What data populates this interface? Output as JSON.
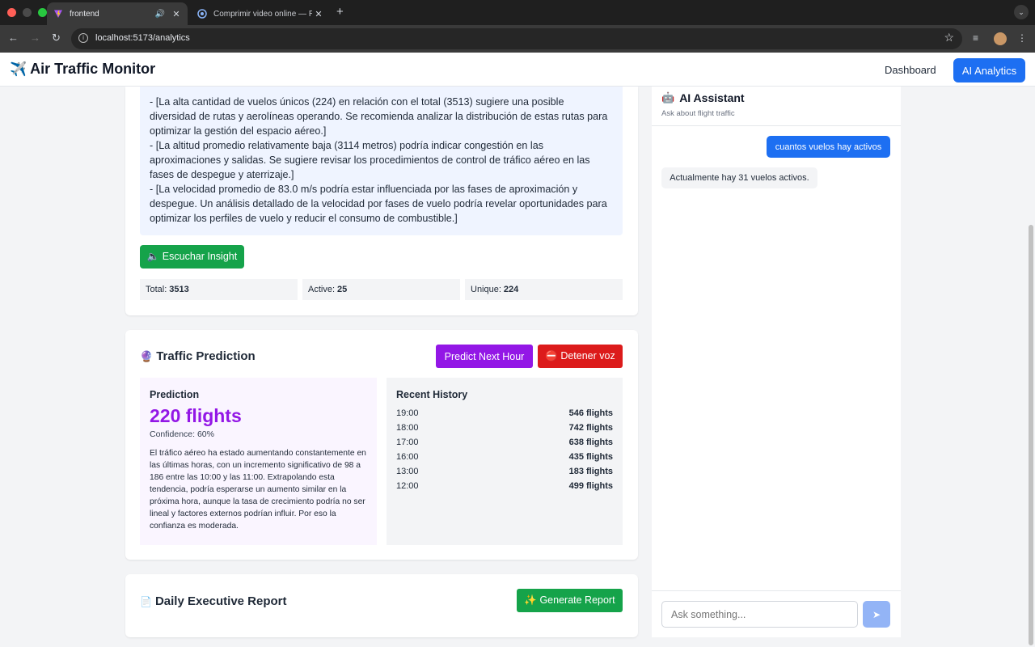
{
  "browser": {
    "tabs": [
      {
        "title": "frontend",
        "favicon": "vite-icon",
        "active": true
      },
      {
        "title": "Comprimir video online — Re",
        "favicon": "compress-icon",
        "active": false
      }
    ],
    "new_tab_symbol": "+",
    "url": "localhost:5173/analytics",
    "close_symbol": "✕",
    "audio_symbol": "🔊",
    "star_symbol": "☆"
  },
  "header": {
    "brand_icon": "✈️",
    "brand": "Air Traffic Monitor",
    "nav": {
      "dashboard": "Dashboard",
      "ai_analytics": "AI Analytics"
    }
  },
  "insight": {
    "paragraphs": [
      "- [La alta cantidad de vuelos únicos (224) en relación con el total (3513) sugiere una posible diversidad de rutas y aerolíneas operando. Se recomienda analizar la distribución de estas rutas para optimizar la gestión del espacio aéreo.]",
      "- [La altitud promedio relativamente baja (3114 metros) podría indicar congestión en las aproximaciones y salidas. Se sugiere revisar los procedimientos de control de tráfico aéreo en las fases de despegue y aterrizaje.]",
      "- [La velocidad promedio de 83.0 m/s podría estar influenciada por las fases de aproximación y despegue. Un análisis detallado de la velocidad por fases de vuelo podría revelar oportunidades para optimizar los perfiles de vuelo y reducir el consumo de combustible.]"
    ],
    "listen_button": "🔈 Escuchar Insight",
    "stats": {
      "total_label": "Total:",
      "total": "3513",
      "active_label": "Active:",
      "active": "25",
      "unique_label": "Unique:",
      "unique": "224"
    }
  },
  "prediction": {
    "icon": "🔮",
    "title": "Traffic Prediction",
    "predict_button": "Predict Next Hour",
    "stop_button": "⛔ Detener voz",
    "box_title": "Prediction",
    "value": "220 flights",
    "confidence": "Confidence: 60%",
    "description": "El tráfico aéreo ha estado aumentando constantemente en las últimas horas, con un incremento significativo de 98 a 186 entre las 10:00 y las 11:00. Extrapolando esta tendencia, podría esperarse un aumento similar en la próxima hora, aunque la tasa de crecimiento podría no ser lineal y factores externos podrían influir. Por eso la confianza es moderada.",
    "history_title": "Recent History",
    "history": [
      {
        "time": "19:00",
        "flights": "546 flights"
      },
      {
        "time": "18:00",
        "flights": "742 flights"
      },
      {
        "time": "17:00",
        "flights": "638 flights"
      },
      {
        "time": "16:00",
        "flights": "435 flights"
      },
      {
        "time": "13:00",
        "flights": "183 flights"
      },
      {
        "time": "12:00",
        "flights": "499 flights"
      }
    ]
  },
  "report": {
    "icon": "📄",
    "title": "Daily Executive Report",
    "button": "✨ Generate Report"
  },
  "assistant": {
    "icon": "🤖",
    "title": "AI Assistant",
    "subtitle": "Ask about flight traffic",
    "messages": [
      {
        "role": "user",
        "text": "cuantos vuelos hay activos"
      },
      {
        "role": "bot",
        "text": "Actualmente hay 31 vuelos activos."
      }
    ],
    "input_placeholder": "Ask something...",
    "send_symbol": "➤"
  },
  "colors": {
    "primary": "#1d6ff2",
    "success": "#15a34a",
    "purple": "#9317e6",
    "danger": "#dc1b1b"
  }
}
